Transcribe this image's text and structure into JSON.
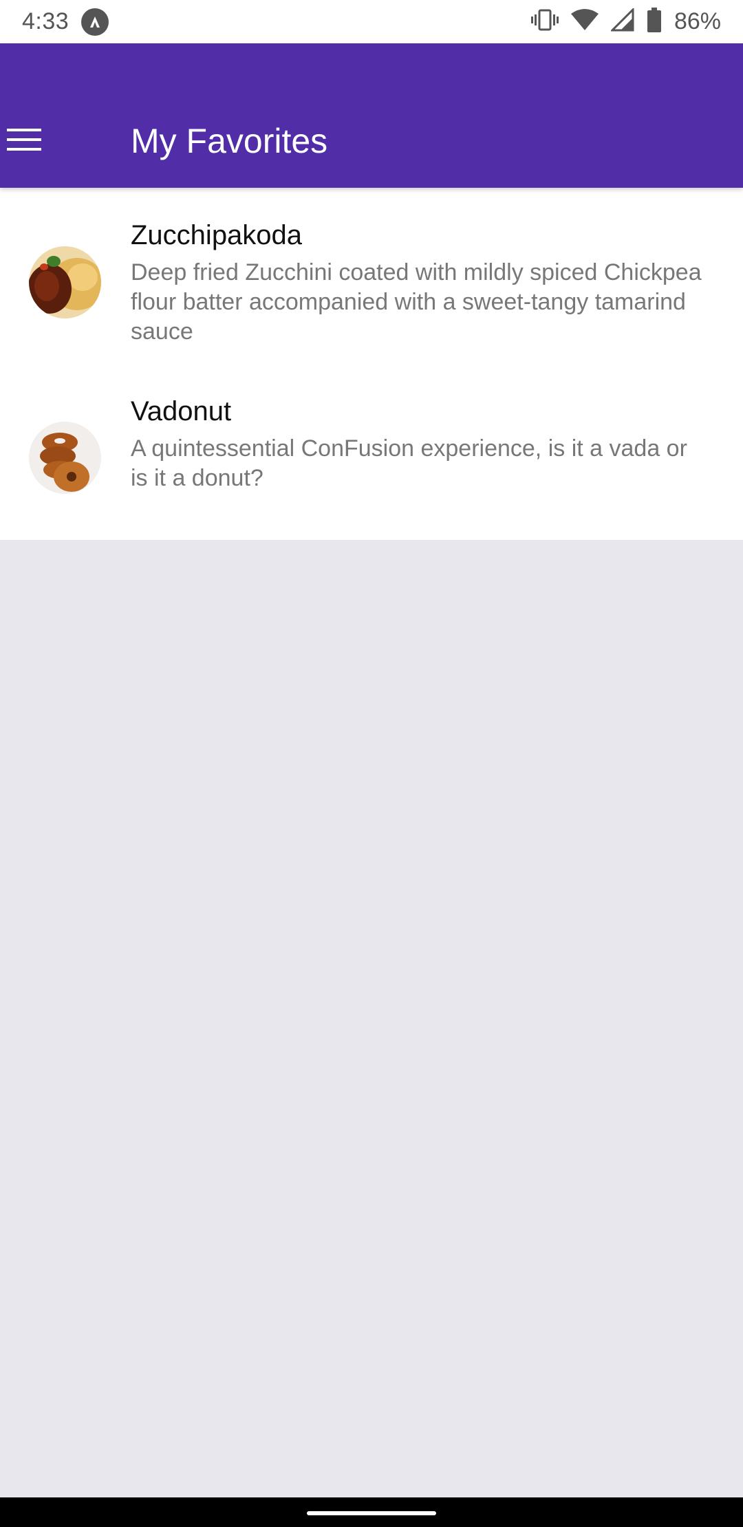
{
  "status_bar": {
    "time": "4:33",
    "battery": "86%",
    "icons": [
      "notification-a-icon",
      "vibrate-icon",
      "wifi-icon",
      "signal-icon",
      "battery-icon"
    ]
  },
  "app_bar": {
    "title": "My Favorites",
    "menu_icon": "hamburger-menu-icon",
    "background": "#512da8"
  },
  "favorites": [
    {
      "title": "Zucchipakoda",
      "description": "Deep fried Zucchini coated with mildly spiced Chickpea flour batter accompanied with a sweet-tangy tamarind sauce"
    },
    {
      "title": "Vadonut",
      "description": "A quintessential ConFusion experience, is it a vada or is it a donut?"
    }
  ]
}
